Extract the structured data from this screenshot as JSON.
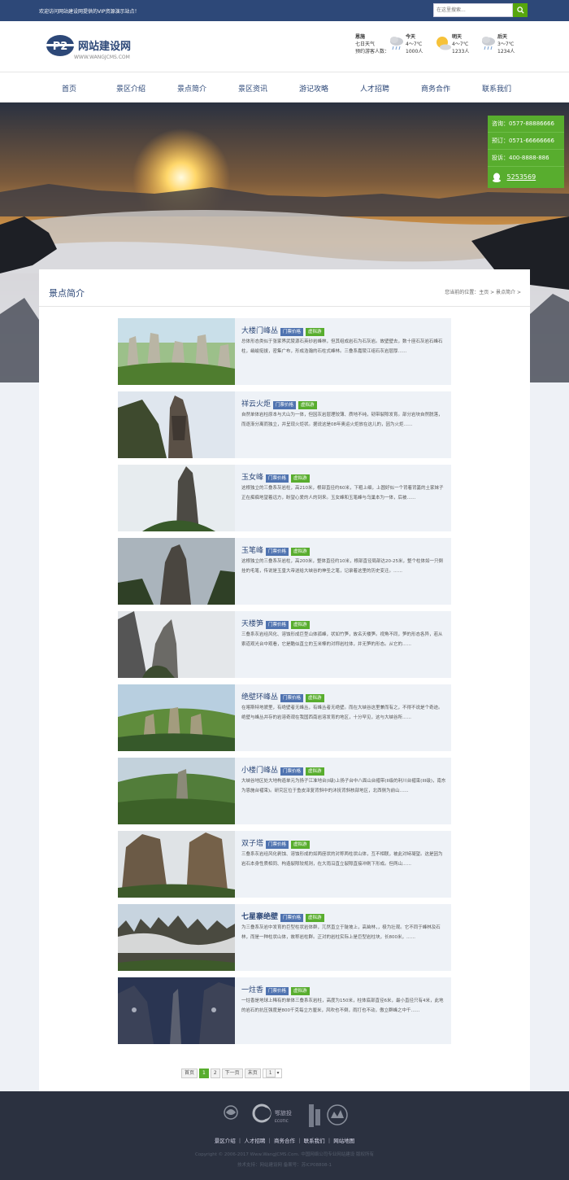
{
  "topbar": {
    "welcome": "欢迎访问网站建设网提供的VIP资源演示站点！",
    "search_placeholder": "在这里搜索..."
  },
  "logo": {
    "name": "网站建设网",
    "url": "WWW.WANGJCMS.COM",
    "mark": "P2"
  },
  "weather": {
    "location": "恩施",
    "line2": "七日天气",
    "line3": "预约游客人数：",
    "days": [
      {
        "label": "今天",
        "temp": "4～7℃",
        "count": "1000人",
        "icon": "cloud-rain-icon"
      },
      {
        "label": "明天",
        "temp": "4～7℃",
        "count": "1233人",
        "icon": "sun-cloud-icon"
      },
      {
        "label": "后天",
        "temp": "3～7℃",
        "count": "1234人",
        "icon": "cloud-rain-icon"
      }
    ]
  },
  "nav": [
    "首页",
    "景区介绍",
    "景点简介",
    "景区资讯",
    "游记攻略",
    "人才招聘",
    "商务合作",
    "联系我们"
  ],
  "side": {
    "consult": "咨询：0577-88886666",
    "book": "预订：0571-66666666",
    "complain": "投诉：400-8888-886",
    "qq": "5253569"
  },
  "panel": {
    "title": "景点简介",
    "breadcrumb": "您当前的位置：主页 > 景点简介 >"
  },
  "tags": {
    "price": "门票价格",
    "virtual": "虚拟游"
  },
  "items": [
    {
      "title": "大楼门峰丛",
      "desc": "总体形态类似于张家界武陵源石英砂岩峰林，但其组成岩石为石灰岩。故壁壁去，数十座石灰岩石峰石柱，峭峻挺拔，密集广布，形成浩瀚的石柱式峰林。三叠系嘉陵江组石灰岩层厚……"
    },
    {
      "title": "祥云火炬",
      "desc": "自然单体岩柱原本与大山为一体，但因灰岩层理较薄、质地不纯，韧带裂隙发育。部分岩块自然脱落，而逐渐分离而独立，并呈现火炬状。据说这是08年奥运火炬放在这儿的，因为火炬……"
    },
    {
      "title": "玉女峰",
      "desc": "这根独立的三叠系灰岩柱，高210米，根部直径约60米，下粗上细，上圆好似一个背着背篓的土家妹子正在痴痴地望着远方，盼望心爱的人的到来。玉女峰和玉笔峰与乌巢本为一体，后被……"
    },
    {
      "title": "玉笔峰",
      "desc": "这根独立的三叠系灰岩柱，高200米，整体直径约10米，根部直径局部达20-25米，整个柱体如一只倒挂的毛笔，传说是玉皇大帝送给大峡谷的神圣之笔，记录着这里的历史变迁。……"
    },
    {
      "title": "天楼笋",
      "desc": "三叠系灰岩经风化、溶蚀形成巨型山体孤峰，状如竹笋，故名天楼笋。视角不同，笋的形态各异，若从索道观光台中观看，它是酷似直立的玉米棒的对称岩柱体，并无笋的形态。从它的……"
    },
    {
      "title": "绝壁环峰丛",
      "desc": "在喀斯特地貌里，有绝壁者无峰丛，有峰丛者无绝壁。而在大峡谷这里兼而有之，不得不说是个奇迹。绝壁与峰丛并存的岩溶奇观在我国西南岩溶发育的地区，十分罕见，这与大峡谷所……"
    },
    {
      "title": "小楼门峰丛",
      "desc": "大峡谷地区处大地构造单元为扬子江准地台(I级)上扬子台中八面山台褶带(II级的利川台褶束(III级)，南东为恩施台褶束)。研究区位于鱼皮泽复背斜中的沐抚背斜核部地区，北西侧为前山……"
    },
    {
      "title": "双子塔",
      "desc": "三叠系灰岩经风化剥蚀、溶蚀形成的如两座状的对称两柱状山体，互不相联，被此对峙凝望。这是因为岩石本身性质相同、构造裂隙较规则，在大雨沿直立裂隙直接冲刷下形成。但两山……"
    },
    {
      "title": "七星寨绝壁",
      "desc": "为三叠系灰岩中发育的巨型柱状岩体群，兀然直立于陡坡上，高耸林，，极为壮观。它不同于峰林及石林，而是一种柱状山体，故称岩柱群。正对的岩柱实际上是巨型岩柱块，长800米，……"
    },
    {
      "title": "一炷香",
      "desc": "一炷香是地球上稀有的单体三叠系灰岩柱，高度为150米，柱体底部直径6米，最小直径只有4米，此地的岩石的抗压强度是800千克每立方厘米，风吹也不倒，雨打也不动，傲立群峰之中千……"
    }
  ],
  "pager": {
    "first": "首页",
    "current": "1",
    "next_page": "2",
    "next": "下一页",
    "last": "末页",
    "select": "1"
  },
  "footer": {
    "logo_caption": "鄂旅投",
    "logo_caption_en": "ECOTIC",
    "links": "景区介绍 ｜ 人才招聘 ｜ 商务合作 ｜ 联系我们 ｜ 网站地图",
    "copyright": "Copyright © 2006-2017 Www.WangJCMS.Com. 中国网络公司专业网站建设 版权所有",
    "support": "技术支持：网站建设网 备案号：苏ICP08808-1"
  }
}
